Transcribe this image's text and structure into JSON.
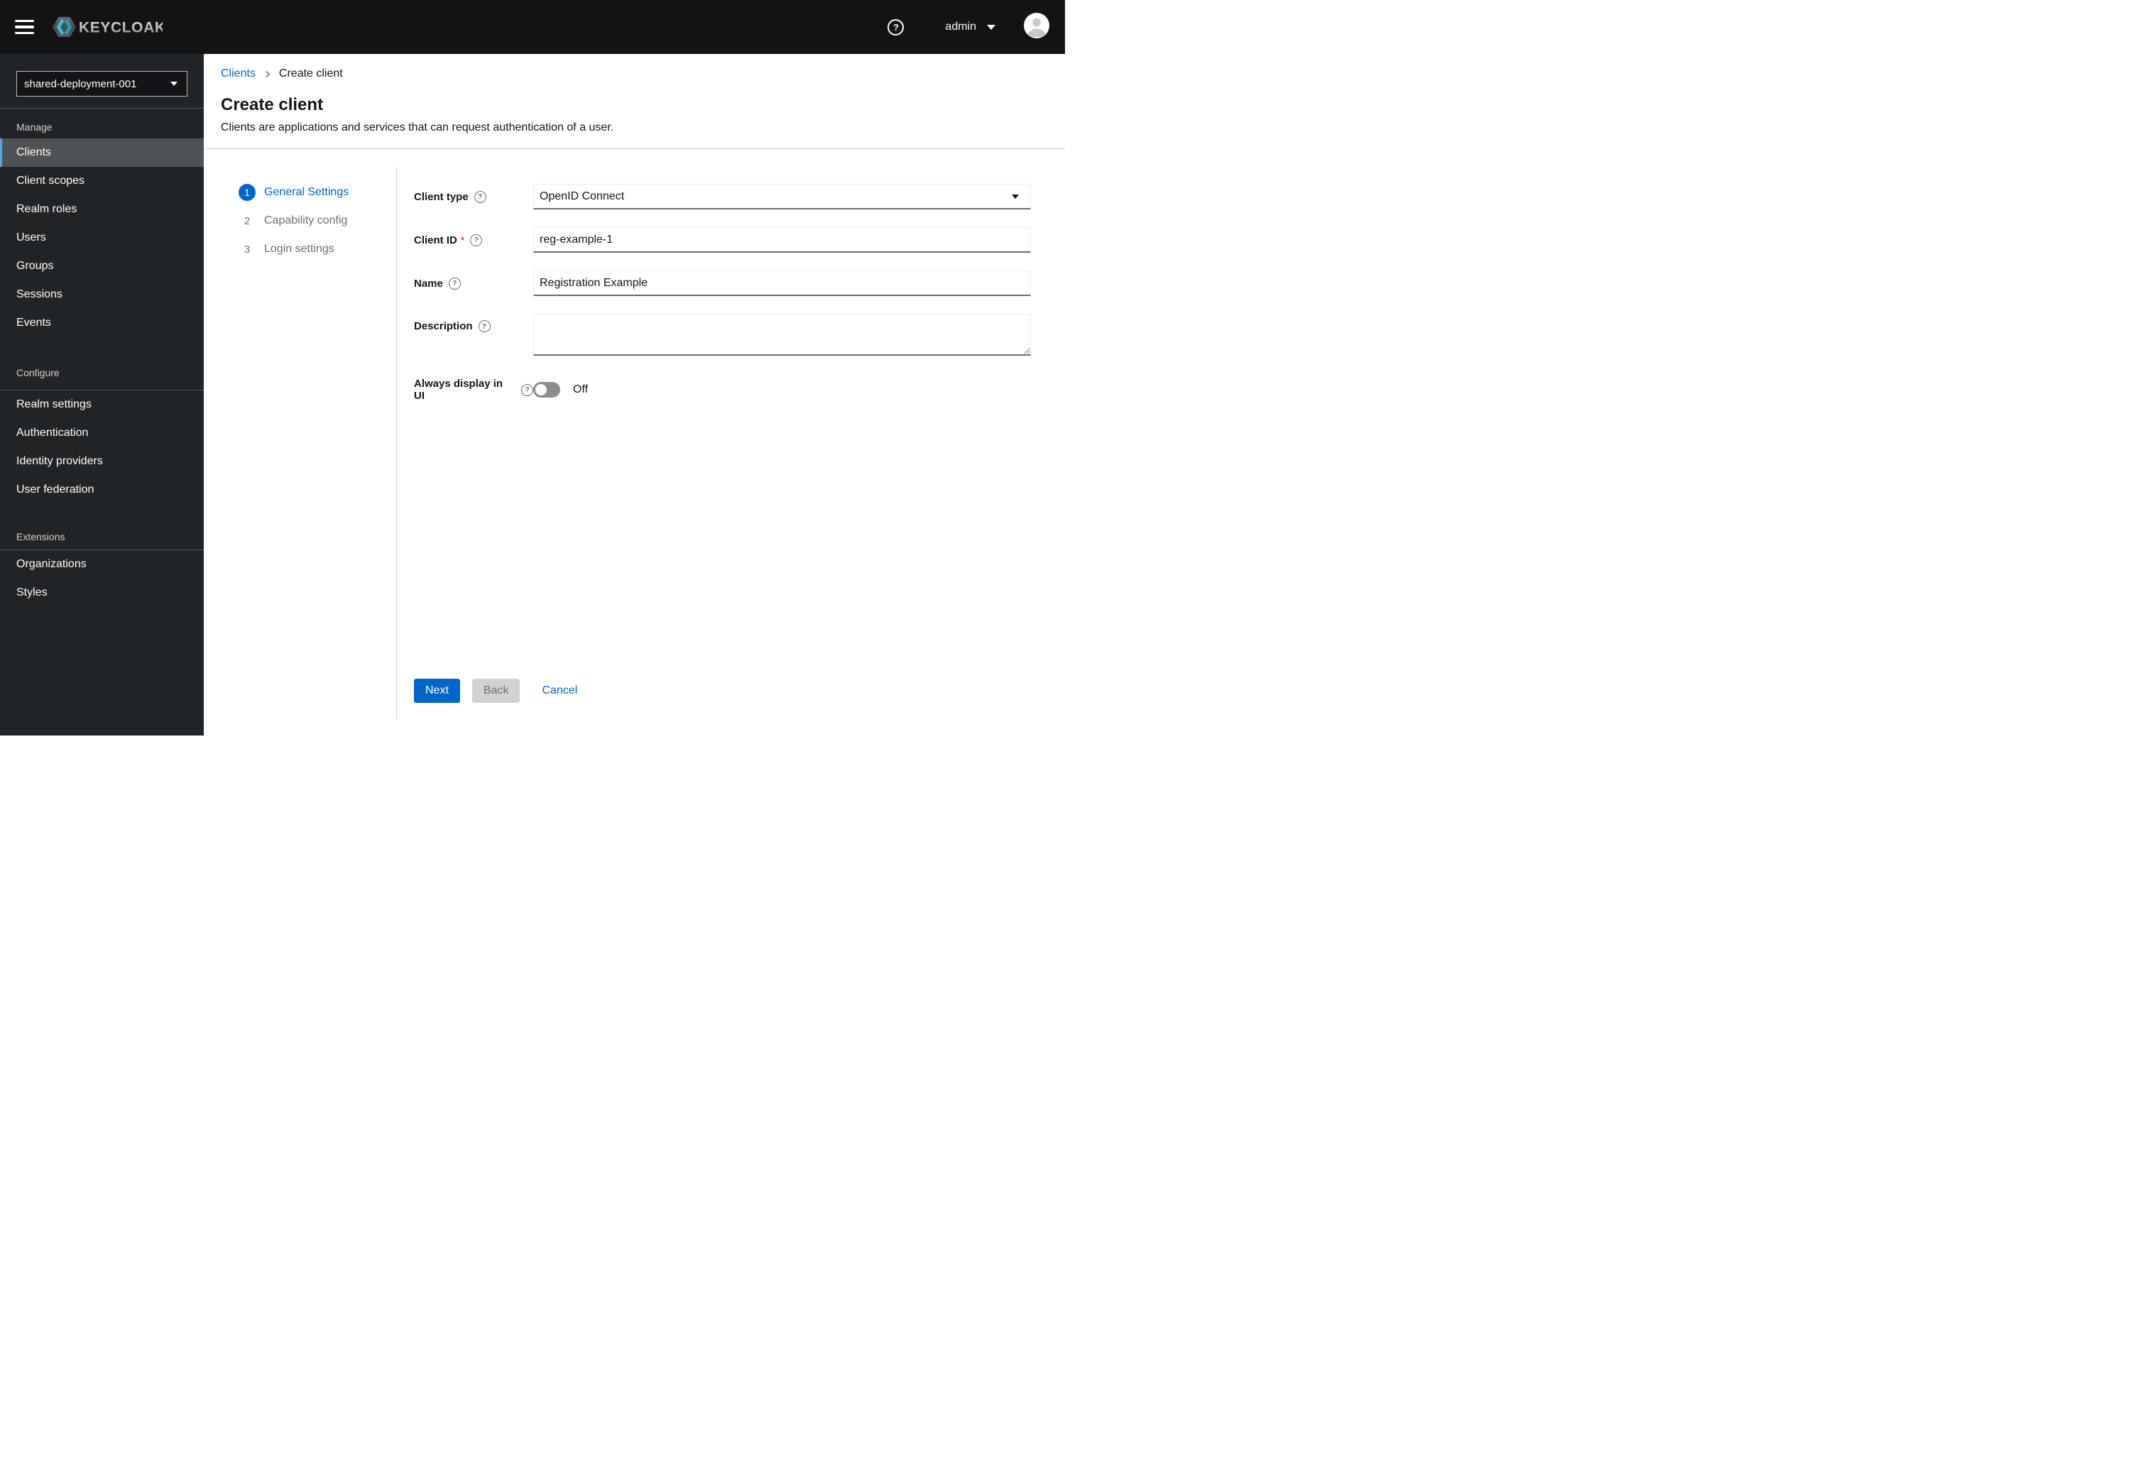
{
  "masthead": {
    "brand": "KEYCLOAK",
    "user": "admin"
  },
  "icons": {
    "question_glyph": "?"
  },
  "sidebar": {
    "realm": "shared-deployment-001",
    "sections": [
      {
        "label": "Manage",
        "items": [
          {
            "label": "Clients",
            "selected": true
          },
          {
            "label": "Client scopes"
          },
          {
            "label": "Realm roles"
          },
          {
            "label": "Users"
          },
          {
            "label": "Groups"
          },
          {
            "label": "Sessions"
          },
          {
            "label": "Events"
          }
        ]
      },
      {
        "label": "Configure",
        "items": [
          {
            "label": "Realm settings"
          },
          {
            "label": "Authentication"
          },
          {
            "label": "Identity providers"
          },
          {
            "label": "User federation"
          }
        ]
      },
      {
        "label": "Extensions",
        "items": [
          {
            "label": "Organizations"
          },
          {
            "label": "Styles"
          }
        ]
      }
    ]
  },
  "breadcrumb": {
    "parent": "Clients",
    "current": "Create client"
  },
  "header": {
    "title": "Create client",
    "subtitle": "Clients are applications and services that can request authentication of a user."
  },
  "wizard": {
    "steps": [
      {
        "num": "1",
        "label": "General Settings"
      },
      {
        "num": "2",
        "label": "Capability config"
      },
      {
        "num": "3",
        "label": "Login settings"
      }
    ],
    "form": {
      "client_type": {
        "label": "Client type",
        "value": "OpenID Connect"
      },
      "client_id": {
        "label": "Client ID",
        "required_mark": "*",
        "value": "reg-example-1"
      },
      "name": {
        "label": "Name",
        "value": "Registration Example"
      },
      "description": {
        "label": "Description",
        "value": ""
      },
      "always_display": {
        "label": "Always display in UI",
        "state_label": "Off"
      }
    },
    "actions": {
      "next": "Next",
      "back": "Back",
      "cancel": "Cancel"
    }
  },
  "colors": {
    "accent": "#0066cc",
    "masthead_bg": "#131314",
    "sidebar_bg": "#212427",
    "nav_selected_bg": "#4f5255",
    "nav_selected_border": "#5ba3e7",
    "link": "#0066cc",
    "divider": "#d2d2d2",
    "input_border_bottom": "#66696d",
    "toggle_off_bg": "#8a8d90",
    "disabled_bg": "#d2d2d2",
    "disabled_text": "#6a6e73",
    "required_red": "#c9190b",
    "logo_cyan": "#35c0e8"
  }
}
